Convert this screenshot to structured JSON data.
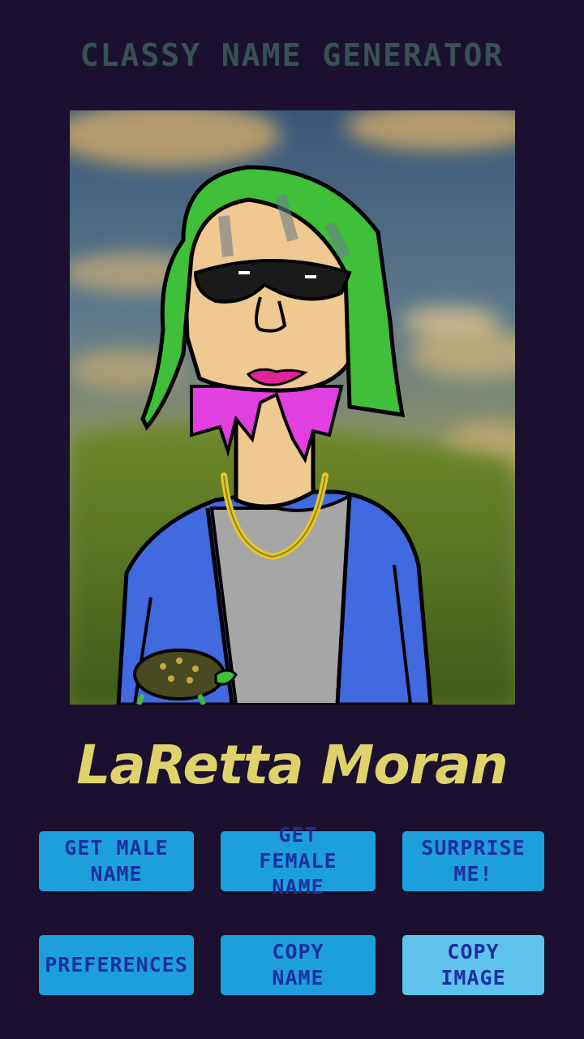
{
  "header": {
    "title": "CLASSY NAME GENERATOR"
  },
  "result": {
    "name": "LaRetta Moran"
  },
  "portrait": {
    "hair_color": "#3fbf3a",
    "shirt_color": "#a6a6a6",
    "jacket_color": "#4169e0",
    "chain_color": "#e4c72a",
    "collar_color": "#e23fe0",
    "skin_color": "#efc892"
  },
  "actions": {
    "male": "GET MALE NAME",
    "female": "GET FEMALE NAME",
    "surprise": "SURPRISE ME!",
    "preferences": "PREFERENCES",
    "copy_name": "COPY NAME",
    "copy_image": "COPY IMAGE"
  },
  "colors": {
    "background": "#1b1030",
    "button": "#1c9fdb",
    "button_active": "#5fc3ee",
    "button_text": "#1c2fa0",
    "name_text": "#ddd36a",
    "title_text": "#3b4f56"
  }
}
